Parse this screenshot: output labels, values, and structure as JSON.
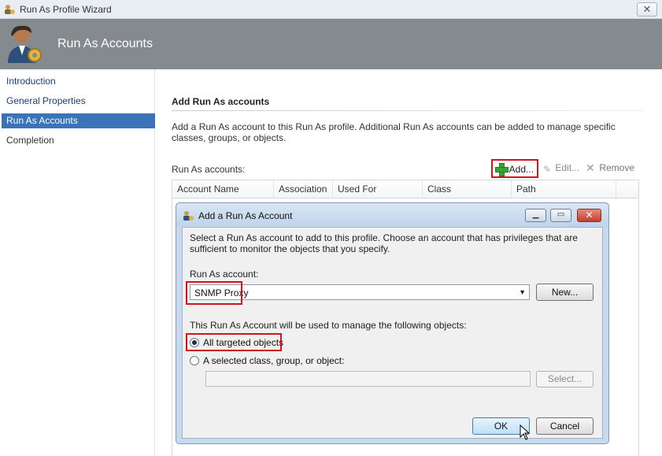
{
  "window": {
    "title": "Run As Profile Wizard",
    "close_glyph": "✕"
  },
  "banner": {
    "heading": "Run As Accounts"
  },
  "nav": {
    "items": [
      {
        "label": "Introduction",
        "active": false
      },
      {
        "label": "General Properties",
        "active": false
      },
      {
        "label": "Run As Accounts",
        "active": true
      },
      {
        "label": "Completion",
        "active": false
      }
    ]
  },
  "main": {
    "section_title": "Add Run As accounts",
    "description": "Add a Run As account to this Run As profile.  Additional Run As accounts can be added to manage specific classes, groups, or objects.",
    "accounts_label": "Run As accounts:",
    "toolbar": {
      "add_label": "Add...",
      "edit_label": "Edit...",
      "remove_label": "Remove"
    },
    "columns": [
      "Account Name",
      "Association",
      "Used For",
      "Class",
      "Path"
    ]
  },
  "dialog": {
    "title": "Add a Run As Account",
    "description": "Select a Run As account to add to this profile.  Choose an account that has privileges that are sufficient to monitor the objects that you specify.",
    "account_label": "Run As account:",
    "account_value": "SNMP Proxy",
    "new_label": "New...",
    "objects_label": "This Run As Account will be used to manage the following objects:",
    "radio_all": "All targeted objects",
    "radio_selected": "A selected class, group, or object:",
    "select_label": "Select...",
    "ok_label": "OK",
    "cancel_label": "Cancel"
  },
  "colors": {
    "banner": "#858a8f",
    "nav_active": "#3a73b8",
    "highlight": "#d2141e",
    "dialog_frame": "#c7d9ee"
  }
}
